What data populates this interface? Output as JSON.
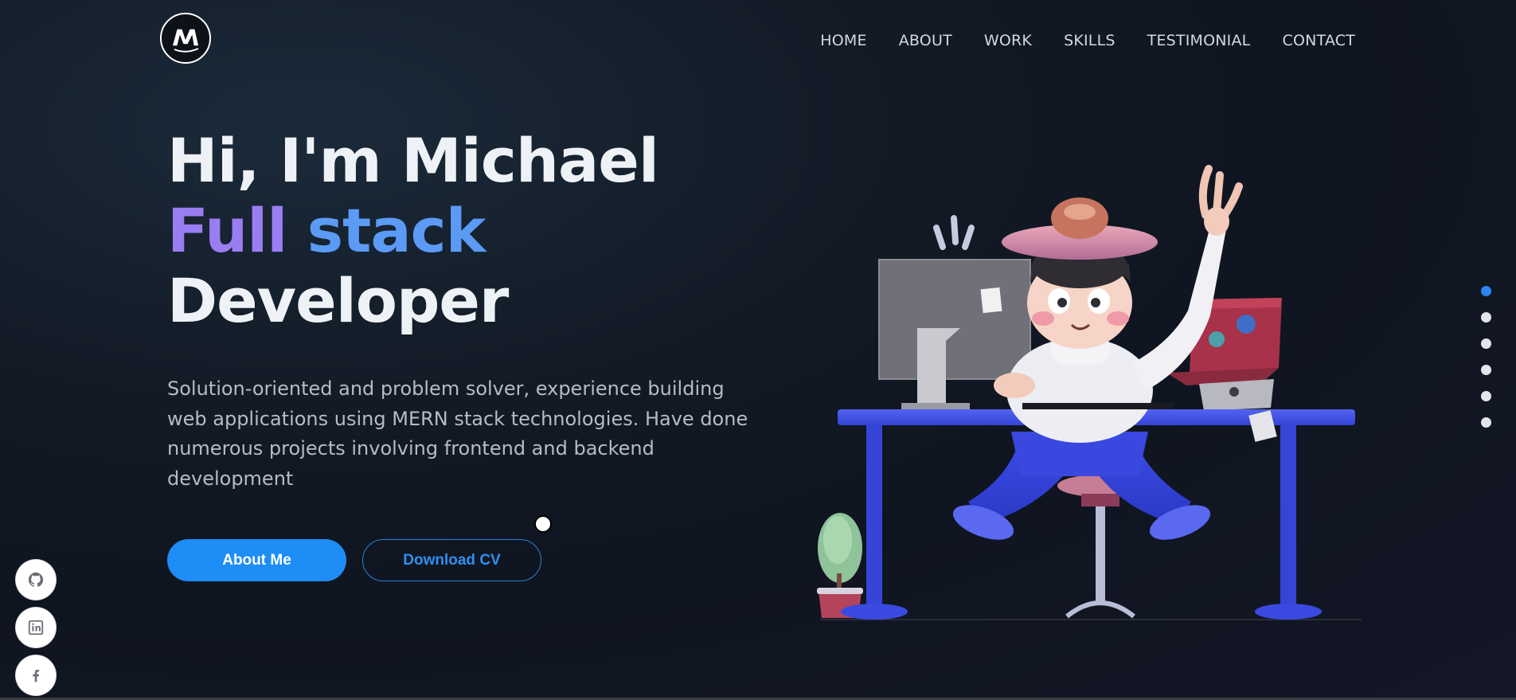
{
  "header": {
    "logo_letter": "M",
    "nav": [
      {
        "label": "HOME"
      },
      {
        "label": "ABOUT"
      },
      {
        "label": "WORK"
      },
      {
        "label": "SKILLS"
      },
      {
        "label": "TESTIMONIAL"
      },
      {
        "label": "CONTACT"
      }
    ]
  },
  "hero": {
    "line1": "Hi, I'm Michael",
    "line2_part1": "Full",
    "line2_part2": " stack",
    "line3": "Developer",
    "description": "Solution-oriented and problem solver, experience building web applications using MERN stack technologies. Have done numerous projects involving frontend and backend development",
    "primary_button": "About Me",
    "secondary_button": "Download CV"
  },
  "social": [
    {
      "icon": "github-icon"
    },
    {
      "icon": "linkedin-icon"
    },
    {
      "icon": "facebook-icon"
    }
  ],
  "section_dots": {
    "count": 6,
    "active_index": 0
  },
  "colors": {
    "accent_blue": "#1e8df5",
    "gradient_purple": "#9a7df2",
    "gradient_blue": "#5b9bf5",
    "desk_blue": "#3b4de0"
  }
}
